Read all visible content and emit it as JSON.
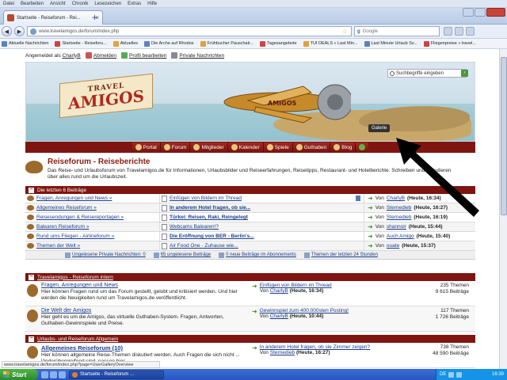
{
  "menubar": [
    "Datei",
    "Bearbeiten",
    "Ansicht",
    "Chronik",
    "Lesezeichen",
    "Extras",
    "Hilfe"
  ],
  "tab": {
    "title": "Startseite - Reiseforum - Rei..."
  },
  "nav": {
    "url": "www.travelamigos.de/forum/index.php",
    "search_engine": "Google",
    "search_placeholder": "Google"
  },
  "bookmarks": [
    "Aktuelle Nachrichten",
    "Startseite - Reiseforu...",
    "Aktuelles",
    "Die Arche auf Rhodos",
    "Frühbucher Pauschalr...",
    "Tagesangebote",
    "TUI DEALS » Last Min...",
    "Last Minute Urlaub Sv...",
    "Fliegenpreise » travel..."
  ],
  "userbar": {
    "logged_in_prefix": "Angemeldet als",
    "username": "CharlyB",
    "logout": "Abmelden",
    "edit_profile": "Profil bearbeiten",
    "private_messages": "Private Nachrichten"
  },
  "banner": {
    "logo_top": "TRAVEL",
    "logo_main": "AMIGOS",
    "search_placeholder": "Suchbegriffe eingeben",
    "gallery_tooltip": "Galerie",
    "plane_label": "AMIGOS"
  },
  "sitenav": [
    "Portal",
    "Forum",
    "Mitglieder",
    "Kalender",
    "Spiele",
    "Guthaben",
    "Blog"
  ],
  "page": {
    "title": "Reiseforum - Reiseberichte",
    "description": "Das Reise- und Urlaubsforum von Travelamigos.de für Informationen, Urlaubsbilder und Reiseerfahrungen, Reisetipps, Restaurant- und Hotelberichte. Schreiben und diskutieren über alles rund um die Urlaubszeit."
  },
  "latest": {
    "header": "Die letzten 6 Beiträge",
    "rows": [
      {
        "forum": "Fragen, Anregungen und News »",
        "thread": "Einfügen von Bildern im Thread",
        "bold": false,
        "by_prefix": "Von",
        "user": "CharlyB",
        "time": "(Heute, 16:34)"
      },
      {
        "forum": "Allgemeines Reiseforum »",
        "thread": "In anderem Hotel fragen, ob sie...",
        "bold": true,
        "by_prefix": "Von",
        "user": "Sternedieb",
        "time": "(Heute, 16:27)"
      },
      {
        "forum": "Reisesendungen & Reisereportagen »",
        "thread": "Türkei: Reisen, Raki, Reingelegt",
        "bold": true,
        "by_prefix": "Von",
        "user": "Sternedieb",
        "time": "(Heute, 16:19)"
      },
      {
        "forum": "Balearen Reiseforum »",
        "thread": "Webcams Balearen!?",
        "bold": false,
        "by_prefix": "Von",
        "user": "shannoir",
        "time": "(Heute, 15:44)"
      },
      {
        "forum": "Rund ums Fliegen - Airlineforum »",
        "thread": "Die Eröffnung von BER - Berlin's...",
        "bold": true,
        "by_prefix": "Von",
        "user": "Auch Amigo",
        "time": "(Heute, 15:40)"
      },
      {
        "forum": "Themen der Welt »",
        "thread": "Air Food One - Zuhause wie...",
        "bold": false,
        "by_prefix": "Von",
        "user": "ouate",
        "time": "(Heute, 15:37)"
      }
    ],
    "footer": [
      "Ungelesene Private Nachrichten: 0",
      "65 ungelesene Beiträge",
      "0 neue Beiträge im Abonnements",
      "Themen der letzten 24 Stunden"
    ]
  },
  "forum_sections": [
    {
      "header": "Travelamigos - Reiseforum intern",
      "forums": [
        {
          "title": "Fragen, Anregungen und News",
          "desc": "Hier können Fragen rund um das Forum gestellt, gelobt und kritisiert werden. Und hier werden die Neuigkeiten rund um Travelamigos.de veröffentlicht.",
          "last_thread": "Einfügen von Bildern im Thread",
          "by_prefix": "Von",
          "last_user": "CharlyB",
          "last_time": "(Heute, 16:34)",
          "threads": "235 Themen",
          "posts": "9 615 Beiträge"
        },
        {
          "title": "Die Welt der Amigos",
          "desc": "Hier geht es um die Amigos, das virtuelle Guthaben-System. Fragen, Antworten, Guthaben-Gewinnspiele und Preise.",
          "last_thread": "Gewinnspiel zum 400.000sten Posting!",
          "by_prefix": "Von",
          "last_user": "CharlyB",
          "last_time": "(Heute, 10:44)",
          "threads": "117 Themen",
          "posts": "1 726 Beiträge"
        }
      ]
    },
    {
      "header": "Urlaubs- und Reiseforum Allgemein",
      "forums": [
        {
          "title": "Allgemeines Reiseforum (10)",
          "desc": "Hier können allgemeine Reise-Themen diskutiert werden. Auch Fragen die sich nicht ... länderübergreifend sind, passen hier.",
          "last_thread": "In anderem Hotel fragen, ob sie Zimmer zeigen?",
          "by_prefix": "Von",
          "last_user": "Sternedieb",
          "last_time": "(Heute, 16:27)",
          "threads": "738 Themen",
          "posts": "48 590 Beiträge"
        }
      ]
    }
  ],
  "statusbar": "www.travelamigos.de/forum/index.php?page=UserGalleryOverview",
  "taskbar": {
    "start": "Start",
    "item": "Startseite - Reiseforum ...",
    "lang": "DE",
    "clock": "16:39"
  }
}
